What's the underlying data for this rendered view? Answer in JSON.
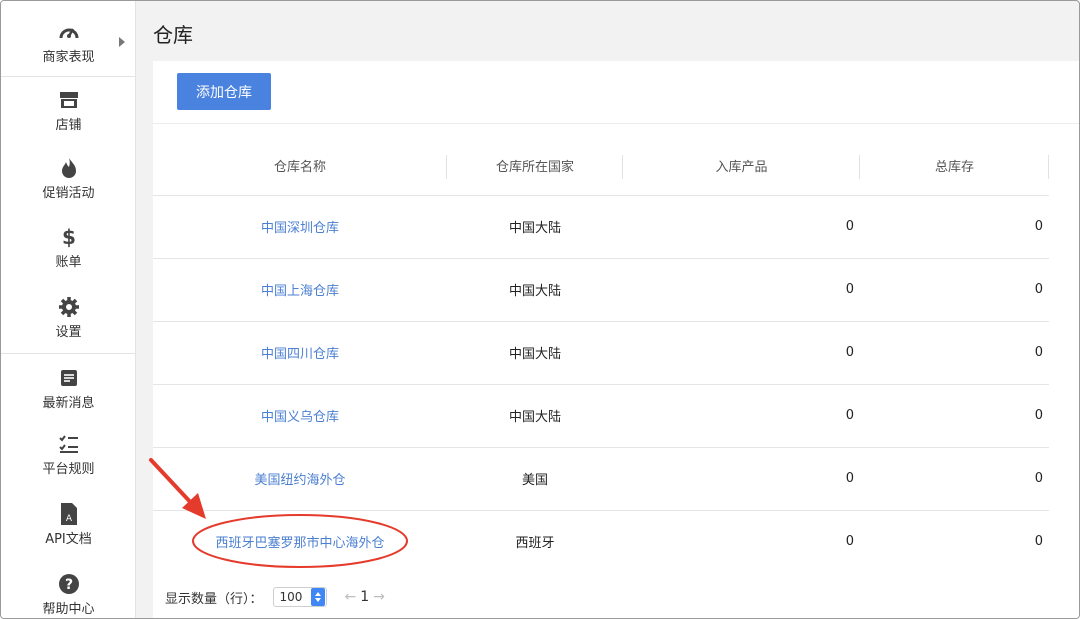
{
  "sidebar": {
    "items": [
      {
        "label": "商家表现",
        "icon": "speedometer-icon"
      },
      {
        "label": "店铺",
        "icon": "store-icon"
      },
      {
        "label": "促销活动",
        "icon": "flame-icon"
      },
      {
        "label": "账单",
        "icon": "dollar-icon"
      },
      {
        "label": "设置",
        "icon": "gear-icon"
      },
      {
        "label": "最新消息",
        "icon": "news-icon"
      },
      {
        "label": "平台规则",
        "icon": "checklist-icon"
      },
      {
        "label": "API文档",
        "icon": "document-icon",
        "icon_letter": "A"
      },
      {
        "label": "帮助中心",
        "icon": "question-icon",
        "icon_letter": "?"
      }
    ]
  },
  "page": {
    "title": "仓库",
    "add_button": "添加仓库"
  },
  "table": {
    "headers": [
      "仓库名称",
      "仓库所在国家",
      "入库产品",
      "总库存"
    ],
    "rows": [
      {
        "name": "中国深圳仓库",
        "country": "中国大陆",
        "inbound": "0",
        "total": "0"
      },
      {
        "name": "中国上海仓库",
        "country": "中国大陆",
        "inbound": "0",
        "total": "0"
      },
      {
        "name": "中国四川仓库",
        "country": "中国大陆",
        "inbound": "0",
        "total": "0"
      },
      {
        "name": "中国义乌仓库",
        "country": "中国大陆",
        "inbound": "0",
        "total": "0"
      },
      {
        "name": "美国纽约海外仓",
        "country": "美国",
        "inbound": "0",
        "total": "0"
      },
      {
        "name": "西班牙巴塞罗那市中心海外仓",
        "country": "西班牙",
        "inbound": "0",
        "total": "0"
      }
    ]
  },
  "pagination": {
    "rows_label": "显示数量（行）：",
    "page_size": "100",
    "prev": "←",
    "current_page": "1",
    "next": "→"
  },
  "colors": {
    "accent": "#4a82df",
    "link": "#4b7fd1",
    "annotation": "#e53b2c"
  }
}
